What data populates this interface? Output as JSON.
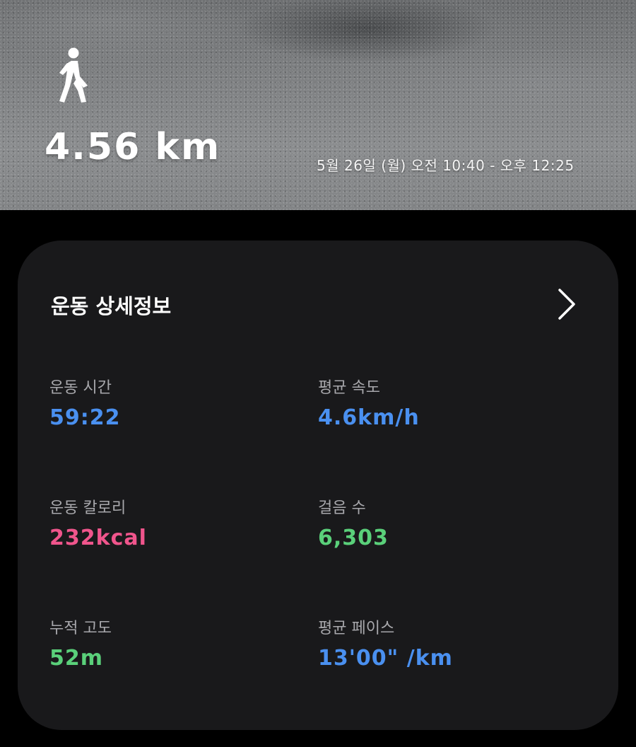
{
  "header": {
    "activity_icon": "walking-person-icon",
    "distance": "4.56 km",
    "datetime": "5월 26일 (월) 오전 10:40 - 오후 12:25"
  },
  "details": {
    "title": "운동 상세정보",
    "chevron_icon": "chevron-right-icon",
    "stats": {
      "duration": {
        "label": "운동 시간",
        "value": "59:22",
        "color": "#4a90f0"
      },
      "avg_speed": {
        "label": "평균 속도",
        "value": "4.6km/h",
        "color": "#4a90f0"
      },
      "calories": {
        "label": "운동 칼로리",
        "value": "232kcal",
        "color": "#f0558c"
      },
      "steps": {
        "label": "걸음 수",
        "value": "6,303",
        "color": "#5ad07a"
      },
      "elevation": {
        "label": "누적 고도",
        "value": "52m",
        "color": "#5ad07a"
      },
      "avg_pace": {
        "label": "평균 페이스",
        "value": "13'00\" /km",
        "color": "#4a90f0"
      }
    }
  }
}
